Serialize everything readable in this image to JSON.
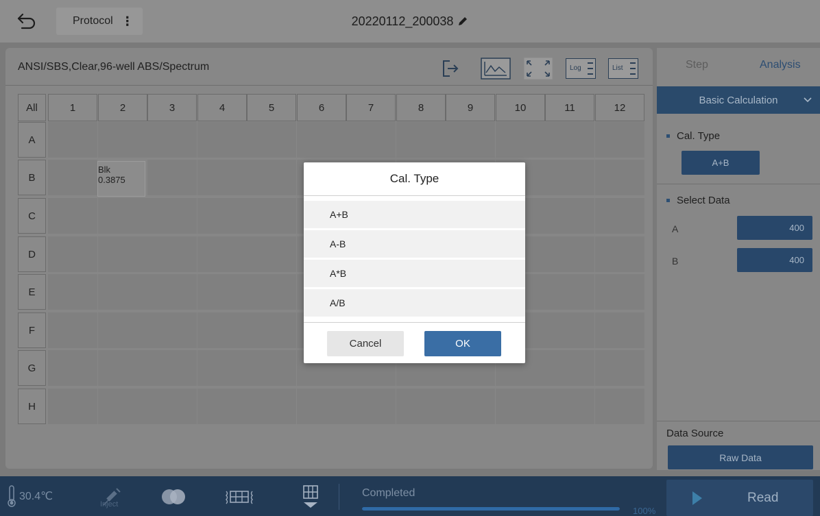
{
  "header": {
    "protocol_label": "Protocol",
    "menu_glyph": "⋮",
    "run_name": "20220112_200038"
  },
  "plate": {
    "description": "ANSI/SBS,Clear,96-well  ABS/Spectrum",
    "toolbar": {
      "log_label": "Log",
      "list_label": "List"
    },
    "all_label": "All",
    "columns": [
      "1",
      "2",
      "3",
      "4",
      "5",
      "6",
      "7",
      "8",
      "9",
      "10",
      "11",
      "12"
    ],
    "rows": [
      "A",
      "B",
      "C",
      "D",
      "E",
      "F",
      "G",
      "H"
    ],
    "blank_well": {
      "row": "B",
      "column": "2",
      "type": "Blk",
      "value": "0.3875"
    }
  },
  "right_panel": {
    "tabs": [
      "Step",
      "Analysis"
    ],
    "active_tab": "Analysis",
    "calculation_dropdown": "Basic Calculation",
    "cal_type_label": "Cal. Type",
    "cal_type_value": "A+B",
    "select_data_label": "Select Data",
    "select_a_label": "A",
    "select_a_value": "400",
    "select_b_label": "B",
    "select_b_value": "400",
    "data_source_label": "Data Source",
    "data_source_value": "Raw Data"
  },
  "dialog": {
    "title": "Cal. Type",
    "options": [
      "A+B",
      "A-B",
      "A*B",
      "A/B"
    ],
    "cancel_label": "Cancel",
    "ok_label": "OK"
  },
  "bottom_bar": {
    "temperature": "30.4℃",
    "inject_label": "Inject",
    "status": "Completed",
    "progress_percent": 100,
    "progress_text": "100%",
    "read_label": "Read"
  },
  "colors": {
    "accent": "#3a6ea5",
    "dark_navy": "#223a55",
    "button_blue": "#28476a"
  }
}
